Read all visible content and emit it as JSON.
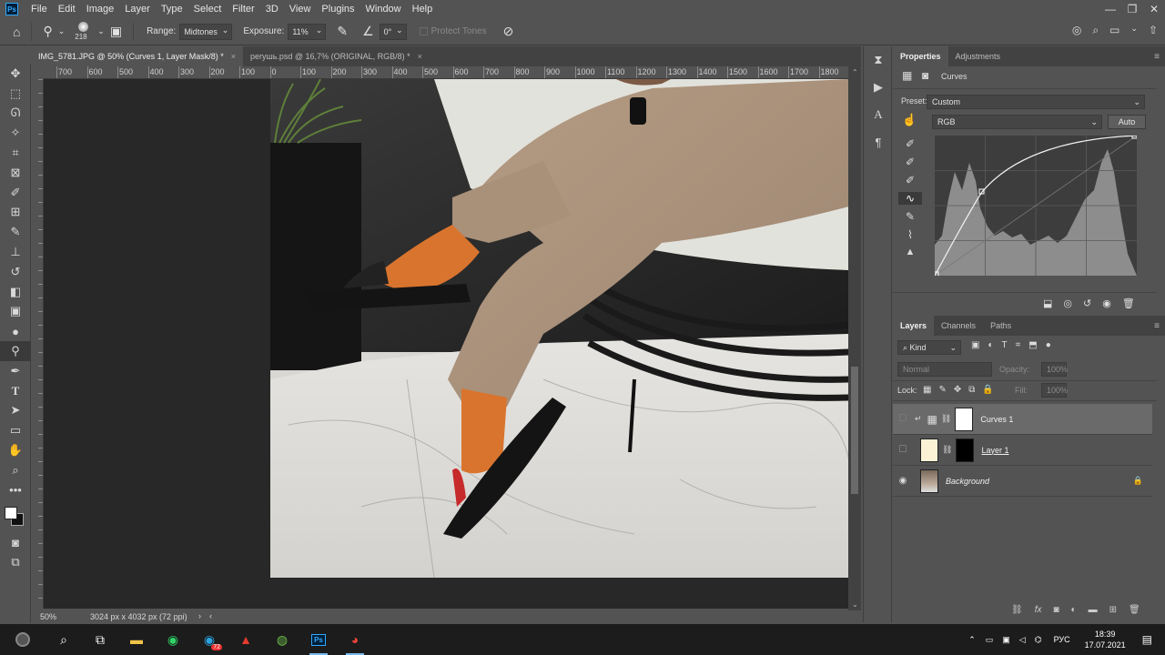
{
  "app": {
    "logo": "Ps"
  },
  "menu": [
    "File",
    "Edit",
    "Image",
    "Layer",
    "Type",
    "Select",
    "Filter",
    "3D",
    "View",
    "Plugins",
    "Window",
    "Help"
  ],
  "options": {
    "brush_size": "218",
    "range_label": "Range:",
    "range_value": "Midtones",
    "exposure_label": "Exposure:",
    "exposure_value": "11%",
    "angle_value": "0°",
    "protect_tones": "Protect Tones"
  },
  "tabs": [
    {
      "label": "IMG_5781.JPG @ 50% (Curves 1, Layer Mask/8) *",
      "active": true
    },
    {
      "label": "peryшь.psd @ 16,7% (ORIGINAL, RGB/8) *",
      "active": false
    }
  ],
  "ruler_top": [
    "700",
    "600",
    "500",
    "400",
    "300",
    "200",
    "100",
    "0",
    "100",
    "200",
    "300",
    "400",
    "500",
    "600",
    "700",
    "800",
    "900",
    "1000",
    "1100",
    "1200",
    "1300",
    "1400",
    "1500",
    "1600",
    "1700",
    "1800"
  ],
  "status": {
    "zoom": "50%",
    "doc_size": "3024 px x 4032 px (72 ppi)"
  },
  "properties": {
    "tabs": [
      "Properties",
      "Adjustments"
    ],
    "title": "Curves",
    "preset_label": "Preset:",
    "preset_value": "Custom",
    "channel_value": "RGB",
    "auto_label": "Auto"
  },
  "layers_panel": {
    "tabs": [
      "Layers",
      "Channels",
      "Paths"
    ],
    "kind_label": "Kind",
    "blend_mode": "Normal",
    "opacity_label": "Opacity:",
    "opacity_value": "100%",
    "lock_label": "Lock:",
    "fill_label": "Fill:",
    "fill_value": "100%",
    "layers": [
      {
        "name": "Curves 1",
        "selected": true
      },
      {
        "name": "Layer 1",
        "selected": false
      },
      {
        "name": "Background",
        "selected": false
      }
    ]
  },
  "taskbar": {
    "lang": "РУС",
    "time": "18:39",
    "date": "17.07.2021",
    "badge": "72"
  }
}
